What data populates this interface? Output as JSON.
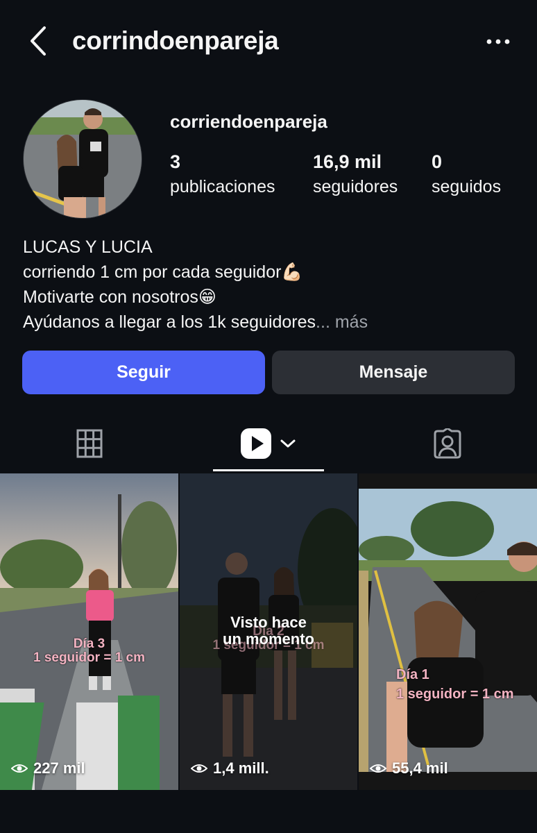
{
  "header": {
    "title": "corrindoenpareja"
  },
  "profile": {
    "username": "corriendoenpareja",
    "stats": [
      {
        "value": "3",
        "label": "publicaciones"
      },
      {
        "value": "16,9 mil",
        "label": "seguidores"
      },
      {
        "value": "0",
        "label": "seguidos"
      }
    ],
    "bio": {
      "line1": "LUCAS Y LUCIA",
      "line2": "corriendo 1 cm por cada seguidor💪🏻",
      "line3": "Motivarte con nosotros😁",
      "line4": "Ayúdanos a llegar a los 1k seguidores",
      "ellipsis": "...",
      "more": " más"
    }
  },
  "actions": {
    "follow_label": "Seguir",
    "message_label": "Mensaje"
  },
  "tabs": [
    {
      "icon": "grid-icon",
      "active": false
    },
    {
      "icon": "reels-icon",
      "active": true
    },
    {
      "icon": "tagged-icon",
      "active": false
    }
  ],
  "reels": [
    {
      "views": "227 mil",
      "overlay_line1": "Día 3",
      "overlay_line2": "1 seguidor = 1 cm"
    },
    {
      "views": "1,4 mill.",
      "seen_line1": "Visto hace",
      "seen_line2": "un momento",
      "overlay_line1": "Día 2",
      "overlay_line2": "1 seguidor = 1 cm"
    },
    {
      "views": "55,4 mil",
      "overlay_line1": "Día 1",
      "overlay_line2": "1 seguidor = 1 cm"
    }
  ],
  "colors": {
    "background": "#0c0f14",
    "follow_button": "#4c61f5",
    "message_button": "#2c2f35",
    "muted_text": "#a0a4ab"
  }
}
